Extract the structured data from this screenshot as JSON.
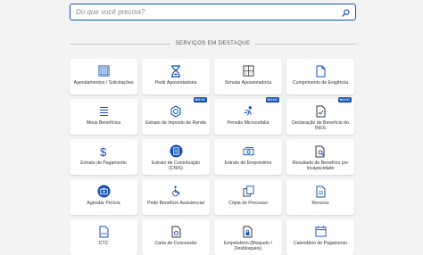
{
  "search": {
    "placeholder": "Do que você precisa?"
  },
  "section": {
    "title": "SERVIÇOS EM DESTAQUE"
  },
  "badge_label": "NOVO",
  "colors": {
    "accent": "#1351b4",
    "icon": "#1351b4"
  },
  "services": [
    {
      "label": "Agendamentos / Solicitações",
      "icon": "calendar-grid-icon"
    },
    {
      "label": "Pedir Aposentadoria",
      "icon": "hourglass-icon"
    },
    {
      "label": "Simular Aposentadoria",
      "icon": "calculator-icon"
    },
    {
      "label": "Cumprimento de Exigência",
      "icon": "document-icon"
    },
    {
      "label": "Meus Benefícios",
      "icon": "list-icon"
    },
    {
      "label": "Extrato de Imposto de Renda",
      "icon": "lion-icon",
      "badge": true
    },
    {
      "label": "Pensão Microcefalia",
      "icon": "child-icon",
      "badge": true
    },
    {
      "label": "Declaração de Benefício do INSS",
      "icon": "document-check-icon",
      "badge": true
    },
    {
      "label": "Extrato de Pagamento",
      "icon": "dollar-icon"
    },
    {
      "label": "Extrato de Contribuição (CNIS)",
      "icon": "clipboard-icon"
    },
    {
      "label": "Extrato de Empréstimo",
      "icon": "money-icon"
    },
    {
      "label": "Resultado de Benefício por Incapacidade",
      "icon": "document-search-icon"
    },
    {
      "label": "Agendar Perícia",
      "icon": "medical-case-icon"
    },
    {
      "label": "Pedir Benefício Assistencial",
      "icon": "wheelchair-icon"
    },
    {
      "label": "Cópia de Processo",
      "icon": "copy-icon"
    },
    {
      "label": "Recurso",
      "icon": "document-recurso-icon"
    },
    {
      "label": "CTC",
      "icon": "document-ctc-icon"
    },
    {
      "label": "Carta de Concessão",
      "icon": "document-letter-icon"
    },
    {
      "label": "Empréstimo (Bloqueio / Desbloqueio)",
      "icon": "lock-document-icon"
    },
    {
      "label": "Calendário de Pagamento",
      "icon": "calendar-icon"
    }
  ]
}
